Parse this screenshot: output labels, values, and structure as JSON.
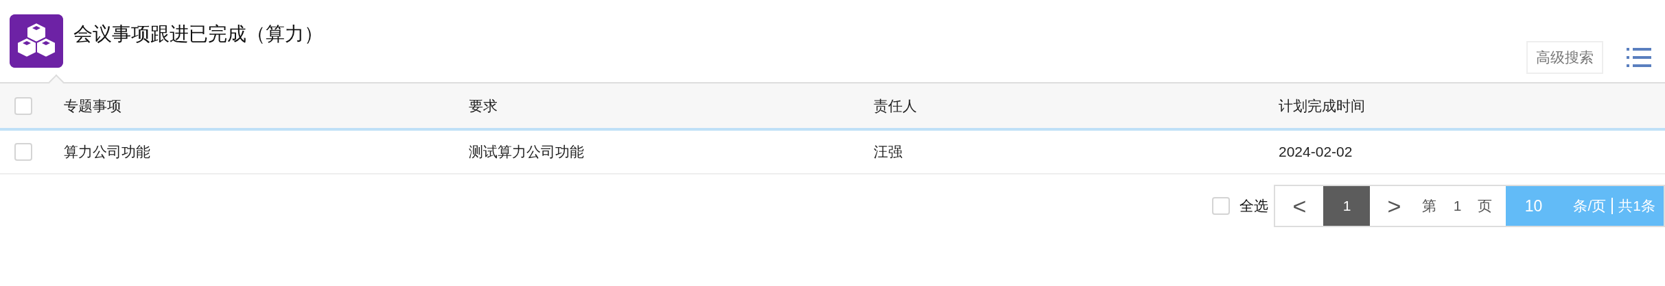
{
  "header": {
    "title": "会议事项跟进已完成（算力）",
    "advanced_search": "高级搜索"
  },
  "table": {
    "header_checked": false,
    "columns": [
      "专题事项",
      "要求",
      "责任人",
      "计划完成时间"
    ],
    "rows": [
      {
        "checked": false,
        "cells": [
          "算力公司功能",
          "测试算力公司功能",
          "汪强",
          "2024-02-02"
        ]
      }
    ]
  },
  "footer": {
    "select_all": {
      "label": "全选",
      "checked": false
    },
    "pager": {
      "prev": "<",
      "pages": [
        {
          "label": "1",
          "selected": true
        }
      ],
      "next": ">",
      "page_prefix": "第",
      "page_input": "1",
      "page_suffix": "页",
      "page_size": "10",
      "per_page": "条/页",
      "total": "共1条"
    }
  }
}
